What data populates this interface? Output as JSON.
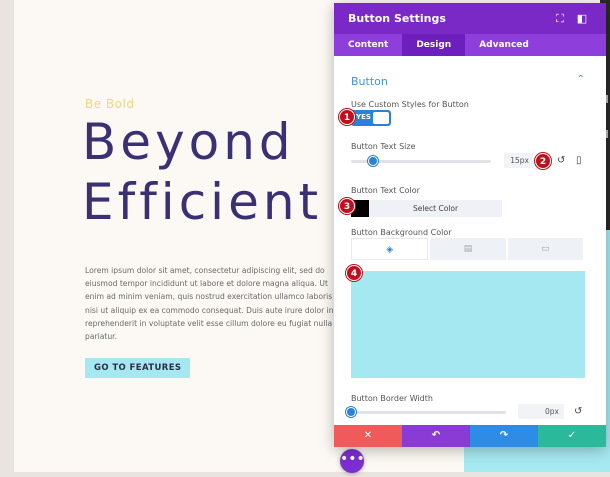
{
  "page": {
    "kicker": "Be Bold",
    "hero_line1": "Beyond",
    "hero_line2": "Efficient",
    "body_text": "Lorem ipsum dolor sit amet, consectetur adipiscing elit, sed do eiusmod tempor incididunt ut labore et dolore magna aliqua. Ut enim ad minim veniam, quis nostrud exercitation ullamco laboris nisi ut aliquip ex ea commodo consequat. Duis aute irure dolor in reprehenderit in voluptate velit esse cillum dolore eu fugiat nulla pariatur.",
    "cta_label": "GO TO FEATURES",
    "edge_letter_1": "I",
    "edge_letter_2": "t",
    "more_label": "•••"
  },
  "modal": {
    "title": "Button Settings",
    "tabs": [
      {
        "label": "Content"
      },
      {
        "label": "Design"
      },
      {
        "label": "Advanced"
      }
    ],
    "active_tab": "Design",
    "section_title": "Button",
    "custom_styles_label": "Use Custom Styles for Button",
    "toggle_label": "YES",
    "toggle_on": true,
    "text_size_label": "Button Text Size",
    "text_size_value": "15px",
    "text_size_slider_fraction": 0.16,
    "text_color_label": "Button Text Color",
    "text_color": "#000000",
    "select_color_label": "Select Color",
    "bg_color_label": "Button Background Color",
    "bg_color": "#a5e8f1",
    "border_width_label": "Button Border Width",
    "border_width_value": "0px",
    "border_width_slider_fraction": 0.0,
    "footer": {
      "cancel_icon": "close-icon",
      "undo_icon": "undo-icon",
      "redo_icon": "redo-icon",
      "save_icon": "check-icon"
    }
  },
  "markers": [
    "1",
    "2",
    "3",
    "4"
  ],
  "colors": {
    "header_purple": "#7a29c7",
    "tabs_purple": "#8e3fdb",
    "accent_blue": "#2b80d8",
    "hero_text": "#3a3175",
    "marker_red": "#c0101f"
  }
}
